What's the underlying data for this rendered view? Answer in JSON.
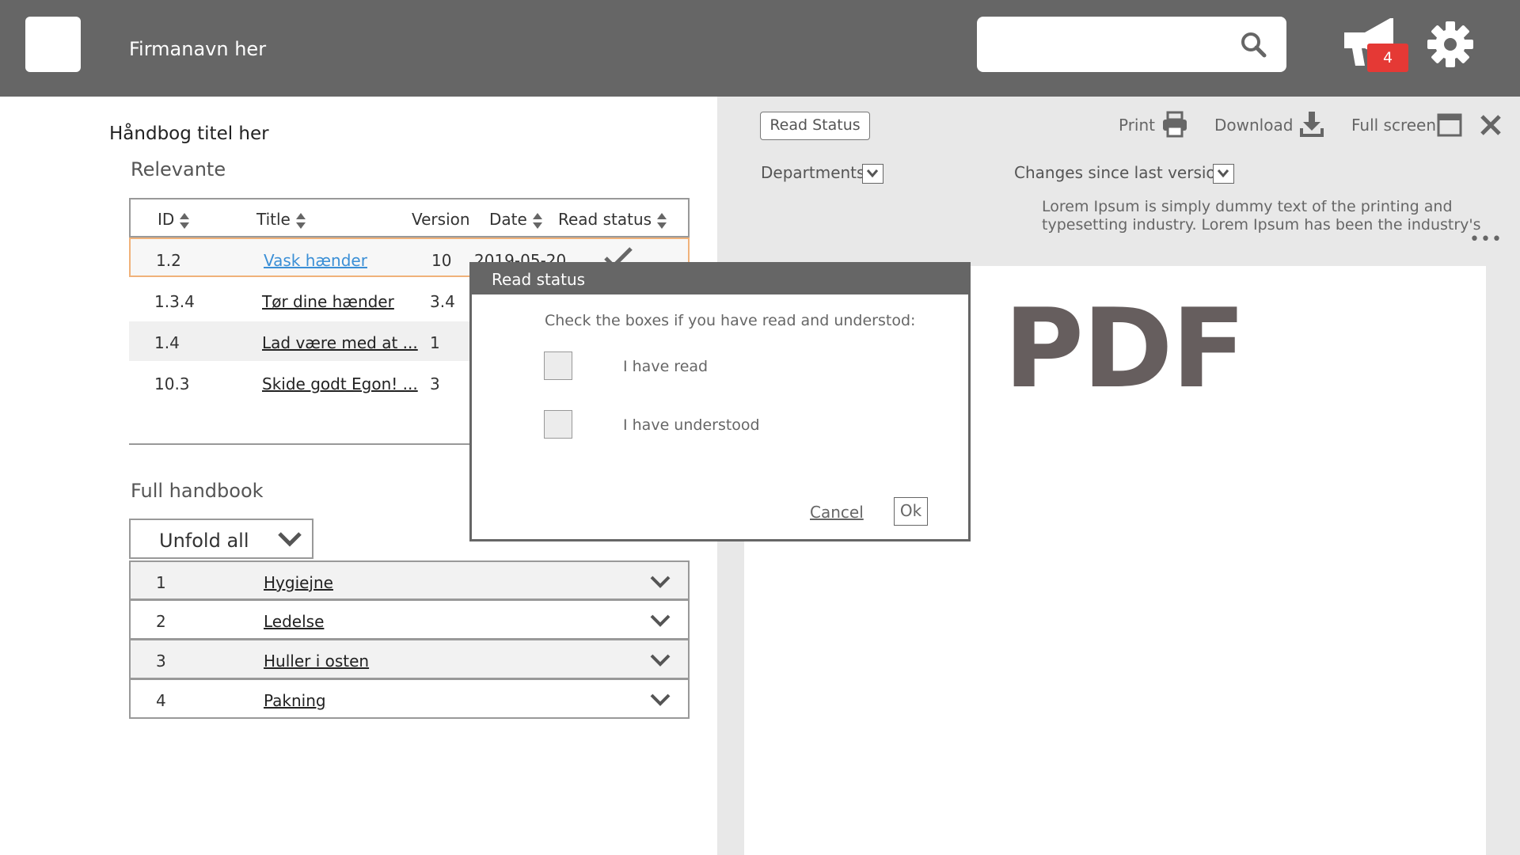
{
  "header": {
    "company_name": "Firmanavn her",
    "search_placeholder": "",
    "notifications_count": "4",
    "colors": {
      "bar": "#666666",
      "badge": "#e53935"
    }
  },
  "left": {
    "handbook_title": "Håndbog titel her",
    "relevant_label": "Relevante",
    "table": {
      "headers": {
        "id": "ID",
        "title": "Title",
        "version": "Version",
        "date": "Date",
        "read_status": "Read status"
      },
      "rows": [
        {
          "id": "1.2",
          "title": "Vask hænder",
          "version": "10",
          "date": "2019-05-20"
        },
        {
          "id": "1.3.4",
          "title": "Tør dine hænder",
          "version": "3.4"
        },
        {
          "id": "1.4",
          "title": "Lad være med at ...",
          "version": "1"
        },
        {
          "id": "10.3",
          "title": "Skide godt Egon! ...",
          "version": "3"
        }
      ]
    },
    "full_handbook_label": "Full handbook",
    "unfold_label": "Unfold all",
    "handbook_sections": [
      {
        "num": "1",
        "name": "Hygiejne"
      },
      {
        "num": "2",
        "name": "Ledelse"
      },
      {
        "num": "3",
        "name": "Huller i osten"
      },
      {
        "num": "4",
        "name": "Pakning"
      }
    ]
  },
  "right": {
    "read_status_button": "Read Status",
    "print_label": "Print",
    "download_label": "Download",
    "fullscreen_label": "Full screen",
    "departments_label": "Departments",
    "changes_label": "Changes since last version",
    "description": "Lorem Ipsum is simply dummy text of the printing and typesetting industry. Lorem Ipsum has been the industry's",
    "more_label": "•••",
    "pdf_placeholder": "PDF"
  },
  "modal": {
    "title": "Read status",
    "instruction": "Check the boxes if you have read and understod:",
    "option_read": "I have read",
    "option_understood": "I have understood",
    "cancel_label": "Cancel",
    "ok_label": "Ok"
  }
}
